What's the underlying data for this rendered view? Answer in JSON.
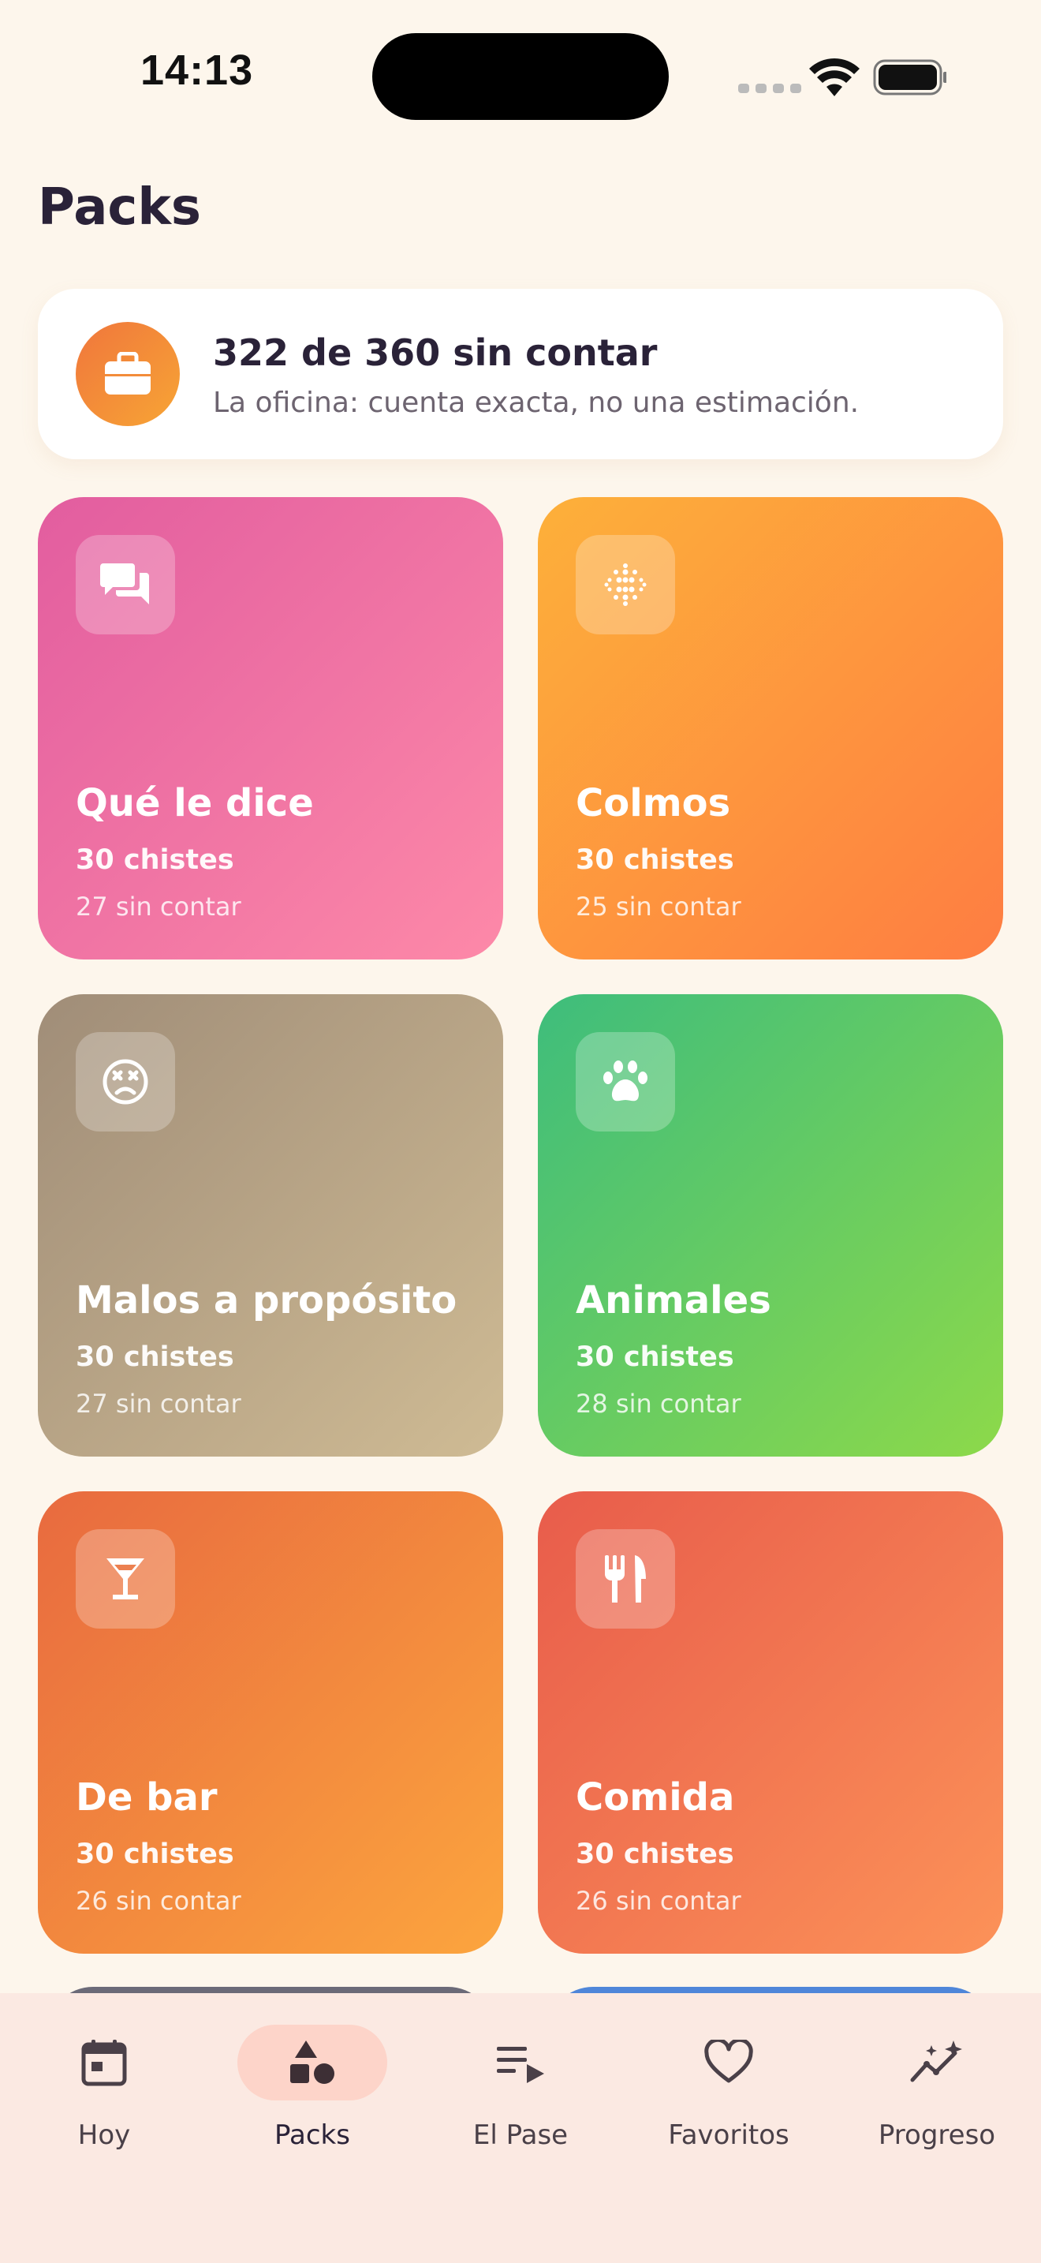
{
  "status_bar": {
    "time": "14:13"
  },
  "page_title": "Packs",
  "summary": {
    "title": "322 de 360 sin contar",
    "subtitle": "La oficina: cuenta exacta, no una estimación.",
    "icon": "briefcase-icon"
  },
  "packs": [
    {
      "name": "Qué le dice",
      "count": "30 chistes",
      "uncounted": "27 sin contar",
      "icon": "chat-bubbles-icon",
      "colors": [
        "#e25d9f",
        "#fd89a8"
      ]
    },
    {
      "name": "Colmos",
      "count": "30 chistes",
      "uncounted": "25 sin contar",
      "icon": "dot-grid-icon",
      "colors": [
        "#fdb03a",
        "#fe7d42"
      ]
    },
    {
      "name": "Malos a propósito",
      "count": "30 chistes",
      "uncounted": "27 sin contar",
      "icon": "dizzy-face-icon",
      "colors": [
        "#a08d78",
        "#cfbb94"
      ]
    },
    {
      "name": "Animales",
      "count": "30 chistes",
      "uncounted": "28 sin contar",
      "icon": "paw-icon",
      "colors": [
        "#3ebd7c",
        "#8dd94a"
      ]
    },
    {
      "name": "De bar",
      "count": "30 chistes",
      "uncounted": "26 sin contar",
      "icon": "cocktail-icon",
      "colors": [
        "#e86a3f",
        "#fca53e"
      ]
    },
    {
      "name": "Comida",
      "count": "30 chistes",
      "uncounted": "26 sin contar",
      "icon": "fork-knife-icon",
      "colors": [
        "#e85c4b",
        "#fc9258"
      ]
    }
  ],
  "tab_bar": {
    "active": "Packs",
    "tabs": [
      {
        "label": "Hoy",
        "icon": "calendar-icon"
      },
      {
        "label": "Packs",
        "icon": "shapes-icon"
      },
      {
        "label": "El Pase",
        "icon": "playlist-icon"
      },
      {
        "label": "Favoritos",
        "icon": "heart-icon"
      },
      {
        "label": "Progreso",
        "icon": "trend-sparkle-icon"
      }
    ]
  }
}
